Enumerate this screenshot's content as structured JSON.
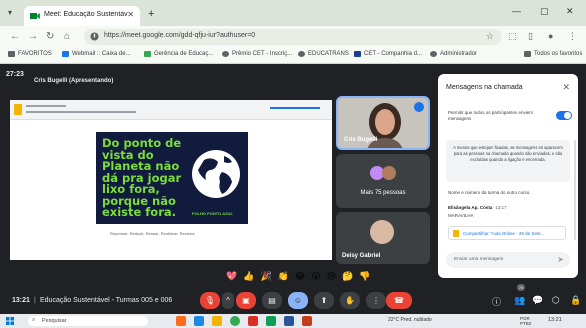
{
  "browser": {
    "tab_title": "Meet: Educação Sustentável",
    "url": "https://meet.google.com/gdd-qfju-iur?authuser=0",
    "window_controls": [
      "—",
      "▢",
      "✕"
    ],
    "bookmarks": [
      "FAVORITOS",
      "Webmail :: Caixa de...",
      "Gerência de Educaç...",
      "Prêmio CET - Inscriç...",
      "EDUCATRANS",
      "CET - Companhia d...",
      "Administrador"
    ],
    "bookmarks_right": "Todos os favoritos"
  },
  "meet": {
    "top_time": "27:23",
    "presenter_label": "Cris Bugelli (Apresentando)",
    "slide": {
      "text": "Do ponto de vista do Planeta não dá pra jogar lixo fora, porque não existe fora.",
      "brand": "FOLHO PONTO AZUL",
      "caption": "Repensar; Reduzir; Reusar; Reutilizar; Reciclar;"
    },
    "tiles": [
      {
        "name": "Cris Bugelli"
      },
      {
        "name": "Mais 75 pessoas"
      },
      {
        "name": "Deisy Gabriel"
      }
    ],
    "reactions": [
      "💖",
      "👍",
      "🎉",
      "👏",
      "😂",
      "😮",
      "😢",
      "🤔",
      "👎"
    ],
    "bottom": {
      "clock": "13:21",
      "separator": "|",
      "meeting_name": "Educação Sustentável - Turmas 005 e 006",
      "participants_badge": "76"
    }
  },
  "chat": {
    "title": "Mensagens na chamada",
    "allow_label": "Permitir que todos os participantes enviem mensagens",
    "notice": "A menos que estejam fixadas, as mensagens só aparecem para as pessoas na chamada quando são enviadas, e são excluídas quando a ligação é encerrada.",
    "message1": "Nome e número da turma do outro curso.",
    "sender": "Elisângela Ap. Costa",
    "sender_time": "13:17",
    "message2": "MARAVILHA",
    "share_text": "Compartilhar \"Aula Online - 28 de Sete...",
    "compose_placeholder": "Enviar uma mensagem"
  },
  "taskbar": {
    "search_placeholder": "Pesquisar",
    "weather": "22°C  Pred. nublado",
    "lang": "POR\nPTB2",
    "clock": "13:21"
  },
  "colors": {
    "slide_bg": "#101b3d",
    "slide_text": "#7ddc3a",
    "end_call": "#ea4335",
    "accent": "#1a73e8"
  }
}
